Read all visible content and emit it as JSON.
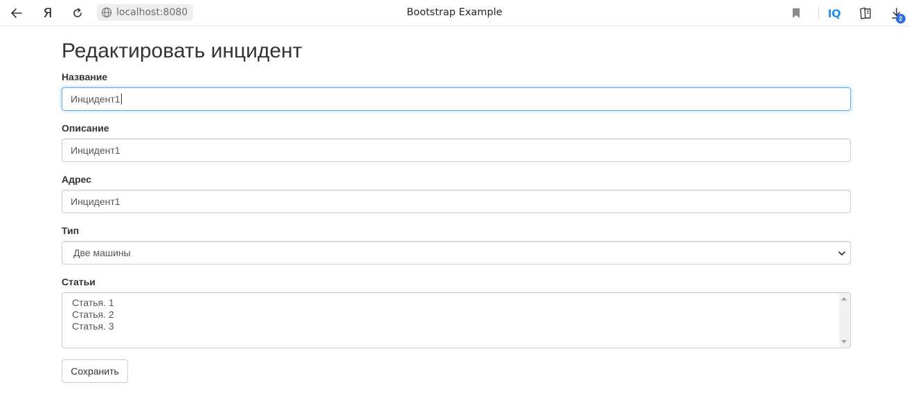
{
  "browser": {
    "address": "localhost:8080",
    "tab_title": "Bootstrap Example",
    "yandex_label": "Я",
    "iq_label": "IQ",
    "downloads_count": "2",
    "icons": [
      "back-arrow-icon",
      "yandex-icon",
      "reload-icon",
      "globe-icon",
      "bookmark-icon",
      "iq-icon",
      "collections-icon",
      "downloads-icon"
    ]
  },
  "page": {
    "title": "Редактировать инцидент"
  },
  "form": {
    "name": {
      "label": "Название",
      "value": "Инцидент1"
    },
    "description": {
      "label": "Описание",
      "value": "Инцидент1"
    },
    "address": {
      "label": "Адрес",
      "value": "Инцидент1"
    },
    "type": {
      "label": "Тип",
      "value": "Две машины"
    },
    "articles": {
      "label": "Статьи",
      "items": [
        "Статья. 1",
        "Статья. 2",
        "Статья. 3"
      ]
    },
    "save_label": "Сохранить"
  },
  "colors": {
    "focus_border": "#66afe9",
    "input_border": "#cccccc",
    "text": "#333333",
    "iq_accent": "#2d8ce6",
    "badge": "#2d6ee6"
  }
}
